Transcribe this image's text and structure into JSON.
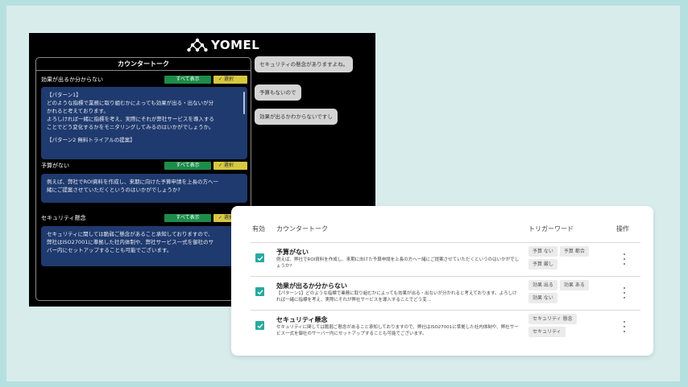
{
  "app": {
    "logo_text": "YOMEL",
    "panel_title": "カウンタートーク",
    "sections": [
      {
        "title": "効果が出るか分からない",
        "show_all_label": "すべて表示",
        "select_label": "✓ 選択",
        "lines": [
          "【パターン1】",
          "どのような指標で業務に取り組むかによっても効果が出る・出ないが分",
          "かれると考えております。",
          "よろしければ一緒に指標を考え、実際にそれが弊社サービスを導入する",
          "ことでどう変化するかをモニタリングしてみるのはいかがでしょうか。",
          "",
          "【パターン2  無料トライアルの提案】"
        ]
      },
      {
        "title": "予算がない",
        "show_all_label": "すべて表示",
        "select_label": "✓ 選択",
        "lines": [
          "例えば、弊社でROI資料を作成し、来期に向けた予算申請を上長の方へ一",
          "緒にご提案させていただくというのはいかがでしょうか?"
        ]
      },
      {
        "title": "セキュリティ懸念",
        "show_all_label": "すべて表示",
        "select_label": "✓ 選択",
        "lines": [
          "セキュリティに関しては脆弱ご懸念があること承知しておりますので、",
          "弊社はISO27001に準拠した社内体制や、弊社サービス一式を御社のサ",
          "バー内にセットアップすることも可能でございます。"
        ]
      }
    ],
    "chat_bubbles": [
      "セキュリティの懸念がありますよね。",
      "予算もないので",
      "効果が出るかわからないですし"
    ]
  },
  "table": {
    "headers": {
      "enabled": "有効",
      "counter_talk": "カウンタートーク",
      "trigger_words": "トリガーワード",
      "actions": "操作"
    },
    "rows": [
      {
        "enabled": true,
        "title": "予算がない",
        "description": "例えば、弊社でROI資料を作成し、来期に向けた予算申請を上長の方へ一緒にご提案させていただくというのはいかがでしょうか?",
        "tags": [
          "予算 ない",
          "予算 都合",
          "予算 厳し"
        ]
      },
      {
        "enabled": true,
        "title": "効果が出るか分からない",
        "description": "【パターン1】どのような指標で業務に取り組むかによっても効果が出る・出ないが分かれると考えております。よろしければ一緒に指標を考え、実際にそれが弊社サービスを導入することでどう変...",
        "tags": [
          "効果 出る",
          "効果 ある",
          "効果 ない"
        ]
      },
      {
        "enabled": true,
        "title": "セキュリティ懸念",
        "description": "セキュリティに関しては脆弱ご懸念があること承知しておりますので、弊社はISO27001に準拠した社内体制や、弊社サービス一式を御社のサーバー内にセットアップすることも可能でございます。",
        "tags": [
          "セキュリティ 懸念",
          "セキュリティ"
        ]
      }
    ]
  },
  "colors": {
    "background": "#b6e0df",
    "card_blue": "#1f3a6e",
    "show_all_green": "#1d8c4a",
    "select_yellow": "#d7c842",
    "checkbox_teal": "#27a9a0"
  }
}
